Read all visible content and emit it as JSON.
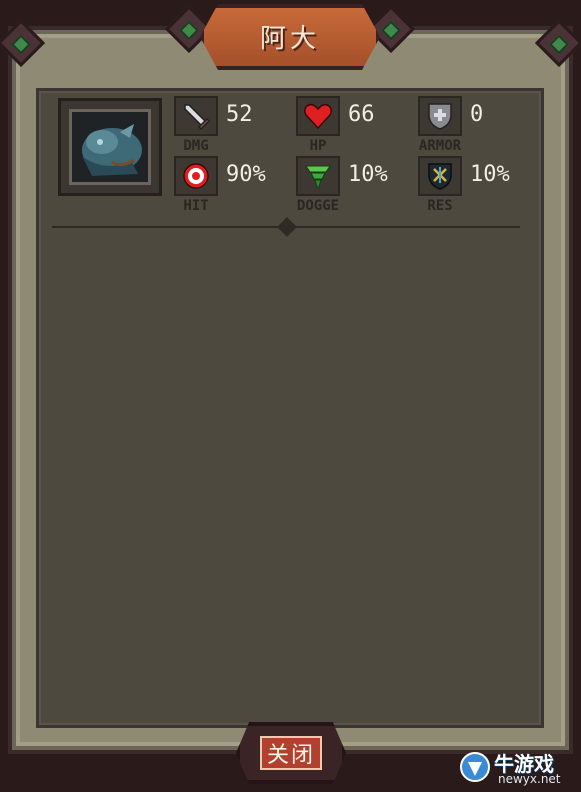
{
  "title": "阿大",
  "stats": [
    {
      "icon": "sword-icon",
      "value": "52",
      "label": "DMG"
    },
    {
      "icon": "heart-icon",
      "value": "66",
      "label": "HP"
    },
    {
      "icon": "shield-icon",
      "value": "0",
      "label": "ARMOR"
    },
    {
      "icon": "target-icon",
      "value": "90%",
      "label": "HIT"
    },
    {
      "icon": "tornado-icon",
      "value": "10%",
      "label": "DOGGE"
    },
    {
      "icon": "resist-shield-icon",
      "value": "10%",
      "label": "RES"
    }
  ],
  "close_label": "关闭",
  "watermark": {
    "name": "牛游戏",
    "url": "newyx.net"
  },
  "colors": {
    "panel": "#4e493f",
    "frame": "#8f8a74",
    "title_plate": "#c86a3a",
    "close_button": "#b2402e"
  }
}
